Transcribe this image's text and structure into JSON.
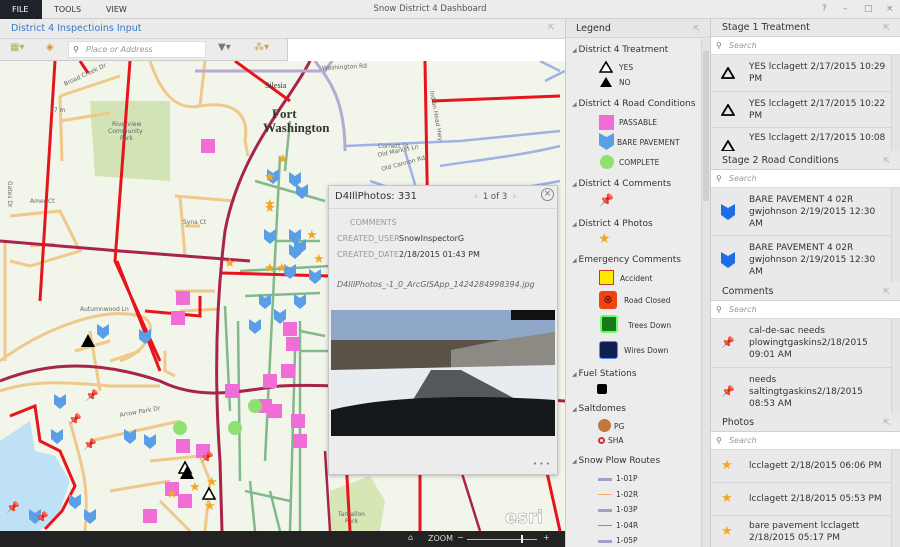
{
  "menu": {
    "file": "FILE",
    "tools": "TOOLS",
    "view": "VIEW"
  },
  "app_title": "Snow District 4 Dashboard",
  "window_controls": {
    "help": "?",
    "minimize": "–",
    "maximize": "□",
    "close": "×"
  },
  "left_panel": {
    "title": "District 4 Inspectioins Input",
    "search_placeholder": "Place or Address",
    "map_labels": {
      "place": "Fort",
      "place2": "Washington",
      "park": "Riverview",
      "park2": "Community",
      "park3": "Park",
      "tpark": "Tantallon",
      "tpark2": "Park",
      "silesia": "Silesia",
      "hwy": "Indian Head Hwy",
      "washington_rd": "Washington Rd",
      "old_market": "Old Market Ln",
      "old_cannon": "Old Cannon Rd",
      "cornett": "Cornett St",
      "syna": "Syna Ct",
      "broad_creek": "Broad Creek Dr",
      "gates": "Gates Dr",
      "autumnwood": "Autumnwood Ln",
      "amer": "Amer Ct",
      "arrow_park": "Arrow Park Dr",
      "elev": "27 m",
      "esri": "esri"
    },
    "zoom_label": "ZOOM"
  },
  "popup": {
    "title": "D4IllPhotos: 331",
    "pager": "1 of 3",
    "fields": [
      {
        "label": "COMMENTS",
        "value": ""
      },
      {
        "label": "CREATED_USER",
        "value": "SnowInspectorG"
      },
      {
        "label": "CREATED_DATE",
        "value": "2/18/2015 01:43 PM"
      }
    ],
    "attachment": "D4IllPhotos_-1_0_ArcGISApp_1424284998394.jpg",
    "more": "• • •"
  },
  "legend": {
    "title": "Legend",
    "groups": [
      {
        "name": "District 4 Treatment",
        "items": [
          "YES",
          "NO"
        ]
      },
      {
        "name": "District 4 Road Conditions",
        "items": [
          "PASSABLE",
          "BARE PAVEMENT",
          "COMPLETE"
        ]
      },
      {
        "name": "District 4 Comments",
        "items": []
      },
      {
        "name": "District 4 Photos",
        "items": []
      },
      {
        "name": "Emergency Comments",
        "items": [
          "Accident",
          "Road Closed",
          "Trees Down",
          "Wires Down"
        ]
      },
      {
        "name": "Fuel Stations",
        "items": []
      },
      {
        "name": "Saltdomes",
        "items": [
          "PG",
          "SHA"
        ]
      },
      {
        "name": "Snow Plow Routes",
        "items": [
          "1-01P",
          "1-02R",
          "1-03P",
          "1-04R",
          "1-05P"
        ]
      }
    ],
    "colors": {
      "passable": "#f06cd6",
      "bare": "#5a9ee8",
      "complete": "#8fe070",
      "star": "#f5a623",
      "route_p": "#a99bc7",
      "route_r_orange": "#f0b070",
      "route_r_green": "#6aa86a"
    }
  },
  "panels": [
    {
      "title": "Stage 1 Treatment",
      "search_placeholder": "Search",
      "rows": [
        "YES  lcclagett 2/17/2015 10:29 PM",
        "YES  lcclagett 2/17/2015 10:22 PM",
        "YES  lcclagett 2/17/2015 10:08"
      ]
    },
    {
      "title": "Stage 2 Road Conditions",
      "search_placeholder": "Search",
      "rows": [
        "BARE PAVEMENT 4 02R gwjohnson 2/19/2015 12:30 AM",
        "BARE PAVEMENT 4 02R gwjohnson 2/19/2015 12:30 AM"
      ]
    },
    {
      "title": "Comments",
      "search_placeholder": "Search",
      "rows": [
        "cal-de-sac needs plowingtgaskins2/18/2015 09:01 AM",
        "needs saltingtgaskins2/18/2015 08:53 AM"
      ]
    },
    {
      "title": "Photos",
      "search_placeholder": "Search",
      "rows": [
        "lcclagett 2/18/2015 06:06 PM",
        "lcclagett 2/18/2015 05:53 PM",
        "bare pavement lcclagett 2/18/2015 05:17 PM"
      ]
    }
  ]
}
